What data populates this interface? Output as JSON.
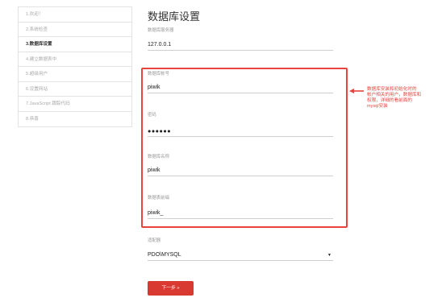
{
  "sidebar": {
    "items": [
      {
        "label": "1.欢迎！"
      },
      {
        "label": "2.系统检查"
      },
      {
        "label": "3.数据库设置"
      },
      {
        "label": "4.建立数据表中"
      },
      {
        "label": "5.超级用户"
      },
      {
        "label": "6.设置网站"
      },
      {
        "label": "7.JavaScript 跟踪代码"
      },
      {
        "label": "8.恭喜"
      }
    ],
    "active_index": 2
  },
  "page_title": "数据库设置",
  "fields": {
    "server": {
      "label": "数据库服务器",
      "value": "127.0.0.1"
    },
    "username": {
      "label": "数据库帐号",
      "value": "piwik"
    },
    "password": {
      "label": "密码",
      "value": "●●●●●●"
    },
    "dbname": {
      "label": "数据库名称",
      "value": "piwik"
    },
    "prefix": {
      "label": "数据表前缀",
      "value": "piwik_"
    },
    "adapter": {
      "label": "适配器",
      "value": "PDO\\MYSQL",
      "arrow": "▼"
    }
  },
  "annotation": {
    "text": "数据库安装和初始化时的\n帐户相关的用户，数据库和\n权限，详细的看前面的\nmysql安装",
    "color": "#e8433c"
  },
  "next_button": {
    "label": "下一步 »"
  },
  "colors": {
    "accent": "#d83a32",
    "highlight": "#e8433c"
  }
}
